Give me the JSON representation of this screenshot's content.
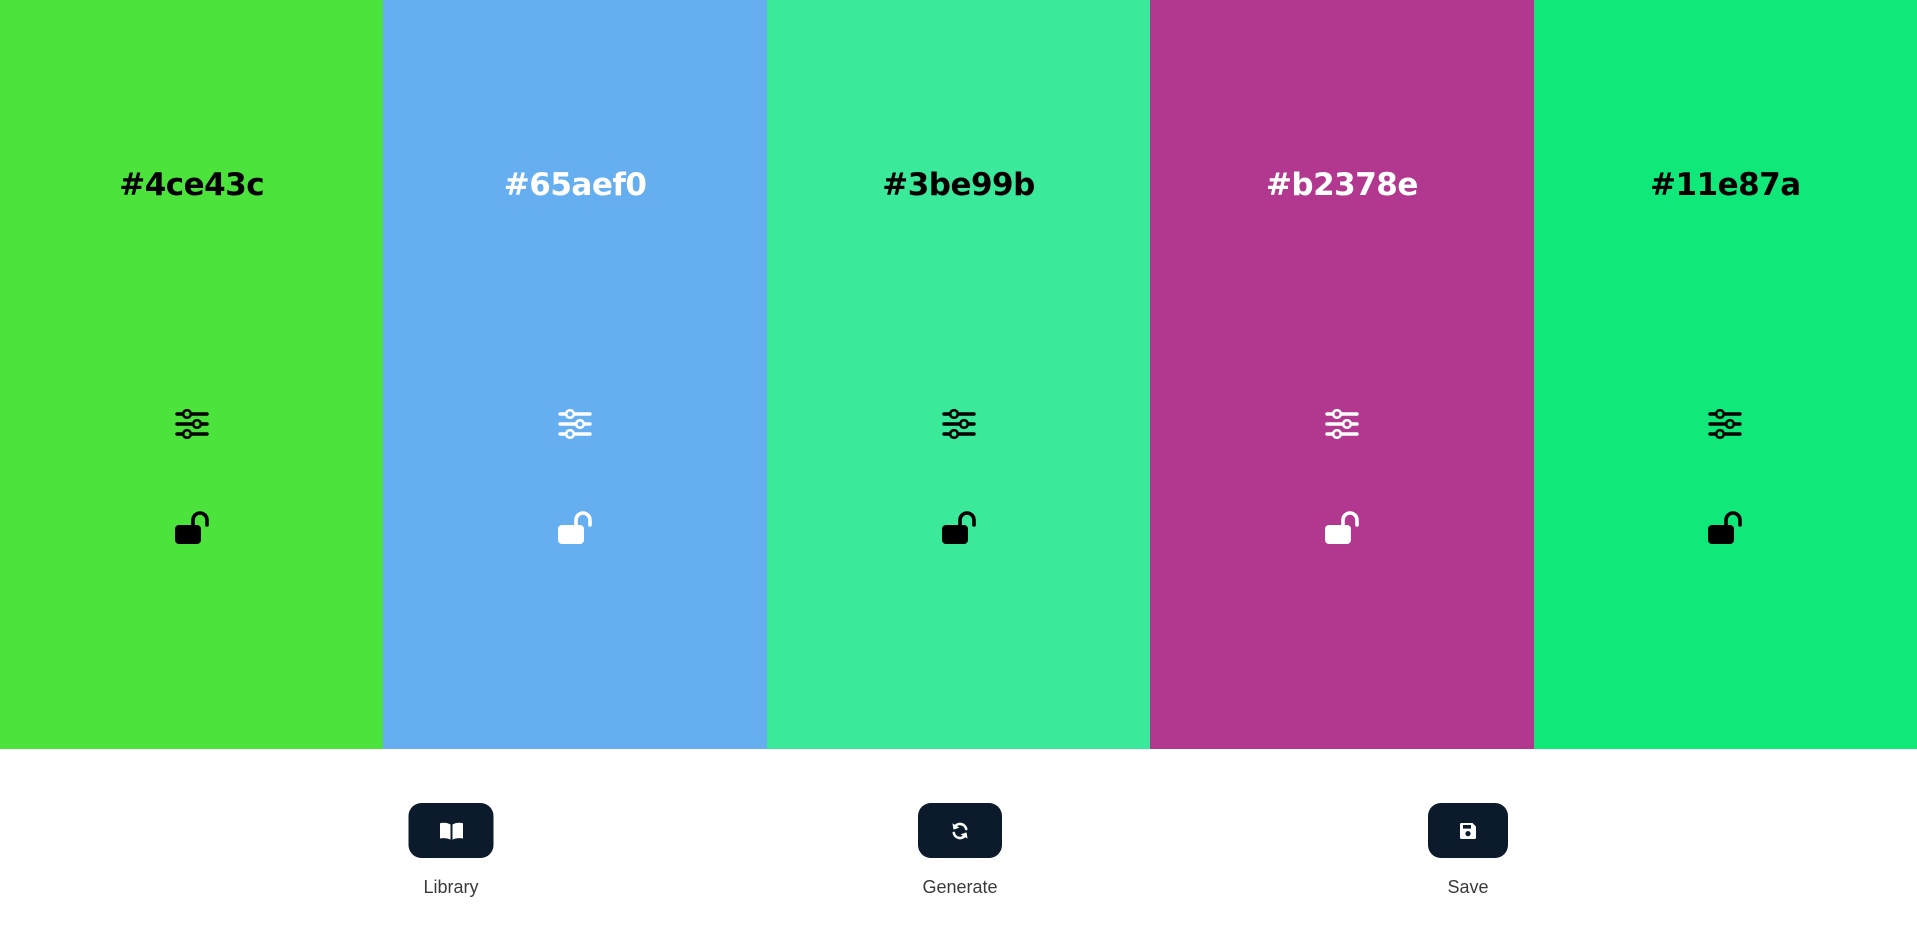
{
  "swatches": [
    {
      "hex": "#4ce43c",
      "background": "#4ce43c",
      "foreground": "#000000"
    },
    {
      "hex": "#65aef0",
      "background": "#65aef0",
      "foreground": "#ffffff"
    },
    {
      "hex": "#3be99b",
      "background": "#3be99b",
      "foreground": "#000000"
    },
    {
      "hex": "#b2378e",
      "background": "#b2378e",
      "foreground": "#ffffff"
    },
    {
      "hex": "#11e87a",
      "background": "#11e87a",
      "foreground": "#000000"
    }
  ],
  "swatch_icons": {
    "adjust": "sliders-icon",
    "lock": "unlocked-padlock-icon"
  },
  "controls": {
    "library": {
      "label": "Library",
      "icon": "book-open-icon"
    },
    "generate": {
      "label": "Generate",
      "icon": "refresh-icon"
    },
    "save": {
      "label": "Save",
      "icon": "floppy-disk-icon"
    }
  },
  "colors": {
    "button_bg": "#0b1b2b",
    "label_text": "#3a3a3a"
  }
}
